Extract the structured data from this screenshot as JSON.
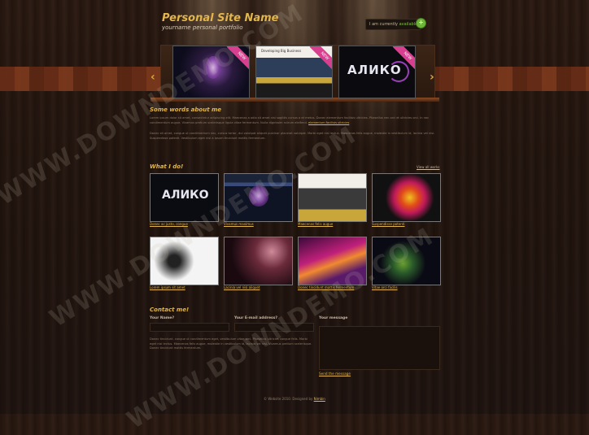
{
  "header": {
    "site_name": "Personal Site Name",
    "site_tagline": "yourname personal portfolio",
    "badge_prefix": "I am currently",
    "badge_status": "available",
    "badge_icon": "plus-circle-icon"
  },
  "slider": {
    "prev_icon": "chevron-left-icon",
    "next_icon": "chevron-right-icon",
    "slides": [
      {
        "name": "slide-1",
        "tag": "NEW"
      },
      {
        "name": "slide-2",
        "tag": "NEW",
        "heading": "Developing Big Business"
      },
      {
        "name": "slide-3",
        "tag": "NEW",
        "text": "АЛИКО"
      }
    ]
  },
  "about": {
    "heading": "Some words about me",
    "para1": "Lorem ipsum dolor sit amet, consectetur adipiscing elit. Maecenas a odio sit amet nisi sagittis cursus a et metus. Donec elementum facilisis ultricies. Phasellus nec orci et ultricies orci. In nec condimentum augue. Vivamus pretium scelerisque ligula vitae fermentum. Nulla dignissim rutrum eleifend.",
    "para1_link": "elementum facilisis ultricies",
    "para2": "Donec sit amet, congue ut condimentum nec, cursus tortor, dui volutpat aliquet pulvinar placerat volutpat. Morbi eget nisl lectus. Maecenas felis augue, molestie in vestibulum id, lacinia vel nisi. Suspendisse potenti. Vestibulum eget nisi a ipsum tincidunt mattis fermentum."
  },
  "work": {
    "heading": "What I do!",
    "view_all": "View all works",
    "items": [
      {
        "caption": "Donec ac justo, congue",
        "thumb": "aliko"
      },
      {
        "caption": "Vivamus maximus",
        "thumb": "dark-site"
      },
      {
        "caption": "Maecenas felis augue",
        "thumb": "business"
      },
      {
        "caption": "Suspendisse potenti",
        "thumb": "splash"
      },
      {
        "caption": "Lorem ipsum sit amet",
        "thumb": "sketch"
      },
      {
        "caption": "Lacinia vel nisi aliquet",
        "thumb": "rays"
      },
      {
        "caption": "Donec tincidunt mattis fermentum",
        "thumb": "waves"
      },
      {
        "caption": "Vitae orci facilis",
        "thumb": "frog"
      }
    ]
  },
  "contact": {
    "heading": "Contact me!",
    "name_label": "Your Name?",
    "email_label": "Your E-mail address?",
    "message_label": "Your message",
    "info": "Donec tincidunt, congue ut condimentum eget, vestibulum vitae orci. Phasellus ultricies congue felis. Morbi eget nisi lectus. Maecenas felis augue, molestie in vestibulum id, lacinia vel nisi. Vivamus pretium scelerisque. Donec tincidunt mattis fermentum.",
    "send_label": "Send the message"
  },
  "footer": {
    "text": "© Website 2010. Designed by",
    "link": "Nimbin"
  },
  "watermark": {
    "text": "WWW.DOWNDEMO.COM"
  },
  "colors": {
    "accent": "#e2b64a",
    "new_tag": "#d6408f",
    "status": "#7fc43a"
  }
}
